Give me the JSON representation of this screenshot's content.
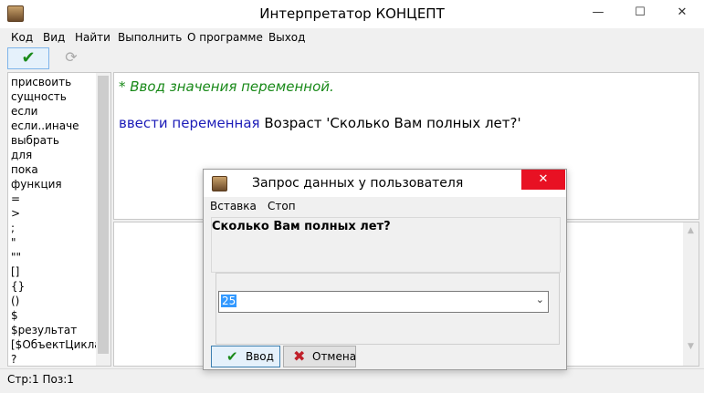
{
  "window": {
    "title": "Интерпретатор КОНЦЕПТ",
    "minimize_glyph": "—",
    "maximize_glyph": "☐",
    "close_glyph": "✕"
  },
  "menu": {
    "items": [
      "Код",
      "Вид",
      "Найти",
      "Выполнить",
      "О программе",
      "Выход"
    ]
  },
  "toolbar": {
    "run_glyph": "✔",
    "refresh_glyph": "⟳",
    "run_icon": "checkmark-icon",
    "refresh_icon": "refresh-icon"
  },
  "keywords": [
    "присвоить",
    "сущность",
    "если",
    "если..иначе",
    "выбрать",
    "для",
    "пока",
    "функция",
    "=",
    ">",
    ";",
    "\"",
    "\"\"",
    "[]",
    "{}",
    "()",
    "$",
    "$результат",
    "[$ОбъектЦикла",
    "?"
  ],
  "editor": {
    "comment": "* Ввод значения переменной.",
    "code_keyword": "ввести переменная",
    "code_rest": " Возраст 'Сколько Вам полных лет?'"
  },
  "status": {
    "text": "Стр:1 Поз:1"
  },
  "dialog": {
    "title": "Запрос данных у пользователя",
    "close_glyph": "✕",
    "menu": [
      "Вставка",
      "Стоп"
    ],
    "prompt": "Сколько Вам полных лет?",
    "input_value": "25",
    "dropdown_glyph": "⌄",
    "ok_label": "Ввод",
    "ok_glyph": "✔",
    "cancel_label": "Отмена",
    "cancel_glyph": "✖"
  },
  "colors": {
    "comment": "#1a8a1a",
    "keyword": "#1c1cb8",
    "selection": "#3399ff",
    "close": "#e81123"
  }
}
